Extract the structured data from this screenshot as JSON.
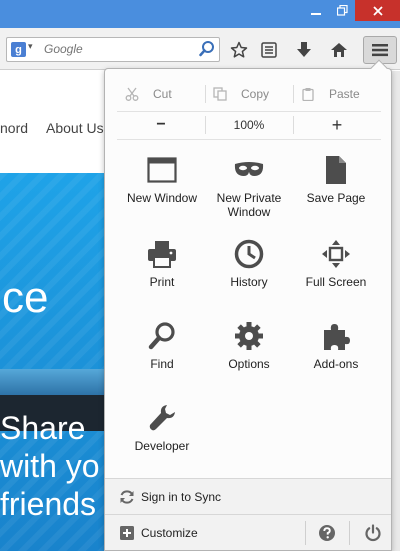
{
  "search": {
    "placeholder": "Google"
  },
  "page_behind": {
    "nav_fragment": "nord",
    "nav_about": "About Us",
    "hero_word": "ce",
    "hero_line1": "Share",
    "hero_line2": "with yo",
    "hero_line3": "friends"
  },
  "menu": {
    "edit": {
      "cut": "Cut",
      "copy": "Copy",
      "paste": "Paste"
    },
    "zoom": {
      "minus": "−",
      "level": "100%",
      "plus": "+"
    },
    "items": [
      {
        "label": "New Window",
        "icon": "window-icon"
      },
      {
        "label": "New Private Window",
        "icon": "private-mask-icon"
      },
      {
        "label": "Save Page",
        "icon": "page-icon"
      },
      {
        "label": "Print",
        "icon": "printer-icon"
      },
      {
        "label": "History",
        "icon": "clock-icon"
      },
      {
        "label": "Full Screen",
        "icon": "fullscreen-icon"
      },
      {
        "label": "Find",
        "icon": "magnifier-icon"
      },
      {
        "label": "Options",
        "icon": "gear-icon"
      },
      {
        "label": "Add-ons",
        "icon": "puzzle-icon"
      },
      {
        "label": "Developer",
        "icon": "wrench-icon"
      }
    ],
    "sync": "Sign in to Sync",
    "customize": "Customize"
  },
  "colors": {
    "titlebar": "#4a8ede",
    "close_button": "#c7312b",
    "icon_dark": "#4d4d4d",
    "hero_blue": "#1b8fd6"
  }
}
